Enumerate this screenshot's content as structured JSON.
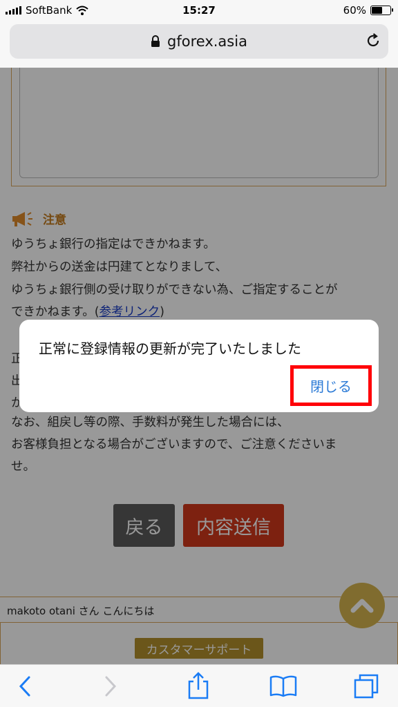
{
  "status_bar": {
    "carrier": "SoftBank",
    "time": "15:27",
    "battery_percent": "60%",
    "battery_level": 0.6
  },
  "browser": {
    "url": "gforex.asia"
  },
  "page": {
    "notice_title": "注意",
    "notice_lines": [
      "ゆうちょ銀行の指定はできかねます。",
      "弊社からの送金は円建てとなりまして、",
      "ゆうちょ銀行側の受け取りができない為、ご指定することが"
    ],
    "notice_line4_before": "できかねます。(",
    "notice_link": "参考リンク",
    "notice_line4_after": ")",
    "hidden_line_starts": [
      "正",
      "出",
      "か"
    ],
    "lines_after_dialog": [
      "なお、組戻し等の際、手数料が発生した場合には、",
      "お客様負担となる場合がございますので、ご注意くださいま",
      "せ。"
    ],
    "back_button": "戻る",
    "send_button": "内容送信",
    "greeting": "makoto otani さん こんにちは",
    "support_button": "カスタマーサポート"
  },
  "dialog": {
    "message": "正常に登録情報の更新が完了いたしました",
    "close_button": "閉じる"
  },
  "colors": {
    "overlay": "rgba(0,0,0,0.4)",
    "highlight_box": "#ff0008",
    "accent": "#c47a1c",
    "send_button": "#d0371c",
    "dialog_button_text": "#2b7ad6"
  },
  "icons": {
    "toolbar": [
      "back-icon",
      "forward-icon",
      "share-icon",
      "bookmarks-icon",
      "tabs-icon"
    ],
    "notice": "megaphone-icon",
    "scroll": "chevron-up-icon"
  }
}
